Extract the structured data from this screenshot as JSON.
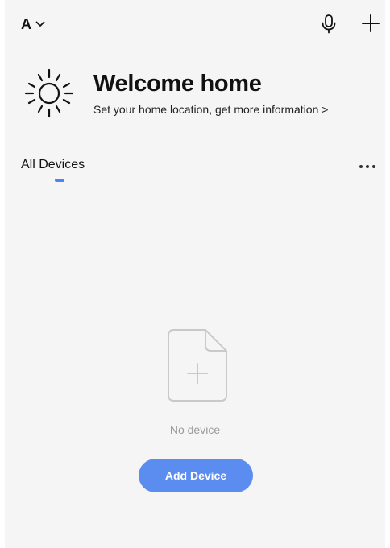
{
  "header": {
    "home_name": "A",
    "icons": {
      "switcher": "chevron-down-icon",
      "voice": "microphone-icon",
      "add": "plus-icon"
    }
  },
  "welcome": {
    "icon": "sun-icon",
    "title": "Welcome home",
    "subtitle": "Set your home location, get more information >"
  },
  "tabs": {
    "all_devices": "All Devices",
    "more_icon": "more-dots-icon"
  },
  "empty_state": {
    "icon": "empty-file-plus-icon",
    "message": "No device",
    "button_label": "Add Device"
  },
  "colors": {
    "accent": "#5b8df1",
    "tab_indicator": "#4c84f0",
    "background": "#f5f5f5",
    "muted_text": "#9a9a9a"
  }
}
